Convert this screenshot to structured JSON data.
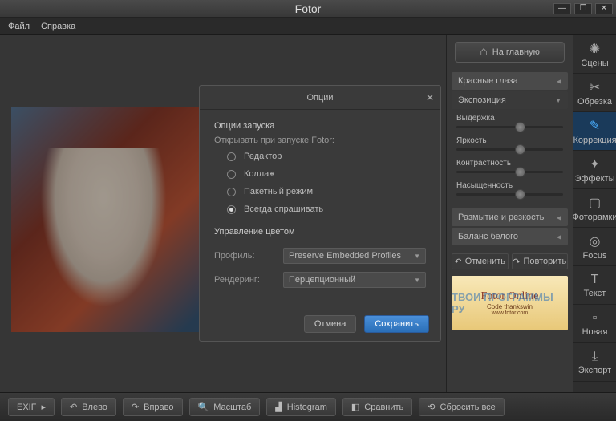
{
  "app_title": "Fotor",
  "menubar": [
    "Файл",
    "Справка"
  ],
  "win": {
    "min": "—",
    "max": "❐",
    "close": "✕"
  },
  "home_btn": "На главную",
  "accordions": {
    "red_eye": "Красные глаза",
    "exposure": "Экспозиция",
    "blur": "Размытие и резкость",
    "wb": "Баланс белого"
  },
  "sliders": {
    "shutter": {
      "label": "Выдержка",
      "pos": 55
    },
    "brightness": {
      "label": "Яркость",
      "pos": 55
    },
    "contrast": {
      "label": "Контрастность",
      "pos": 55
    },
    "saturation": {
      "label": "Насыщенность",
      "pos": 55
    }
  },
  "undo": "Отменить",
  "redo": "Повторить",
  "promo": {
    "title": "Fotor Online",
    "code": "Code   thankswin",
    "site": "www.fotor.com",
    "watermark": "ТВОИ ПРОГРАММЫ РУ"
  },
  "tools": [
    {
      "id": "scenes",
      "label": "Сцены",
      "icon": "✺"
    },
    {
      "id": "crop",
      "label": "Обрезка",
      "icon": "✂"
    },
    {
      "id": "correction",
      "label": "Коррекция",
      "icon": "✎",
      "active": true
    },
    {
      "id": "effects",
      "label": "Эффекты",
      "icon": "✦"
    },
    {
      "id": "frames",
      "label": "Фоторамки",
      "icon": "▢"
    },
    {
      "id": "focus",
      "label": "Focus",
      "icon": "◎"
    },
    {
      "id": "text",
      "label": "Текст",
      "icon": "T"
    },
    {
      "id": "new",
      "label": "Новая",
      "icon": "▫"
    },
    {
      "id": "export",
      "label": "Экспорт",
      "icon": "⤓"
    }
  ],
  "footer": [
    {
      "id": "exif",
      "label": "EXIF",
      "icon": "",
      "chev": "▸"
    },
    {
      "id": "left",
      "label": "Влево",
      "icon": "↶"
    },
    {
      "id": "right",
      "label": "Вправо",
      "icon": "↷"
    },
    {
      "id": "scale",
      "label": "Масштаб",
      "icon": "🔍"
    },
    {
      "id": "histogram",
      "label": "Histogram",
      "icon": "▟"
    },
    {
      "id": "compare",
      "label": "Сравнить",
      "icon": "◧"
    },
    {
      "id": "reset",
      "label": "Сбросить все",
      "icon": "⟲"
    }
  ],
  "dialog": {
    "title": "Опции",
    "launch_section": "Опции запуска",
    "launch_sub": "Открывать при запуске Fotor:",
    "radios": [
      "Редактор",
      "Коллаж",
      "Пакетный режим",
      "Всегда спрашивать"
    ],
    "radio_checked": 3,
    "color_section": "Управление цветом",
    "profile_label": "Профиль:",
    "profile_value": "Preserve Embedded Profiles",
    "render_label": "Рендеринг:",
    "render_value": "Перцепционный",
    "cancel": "Отмена",
    "save": "Сохранить"
  }
}
